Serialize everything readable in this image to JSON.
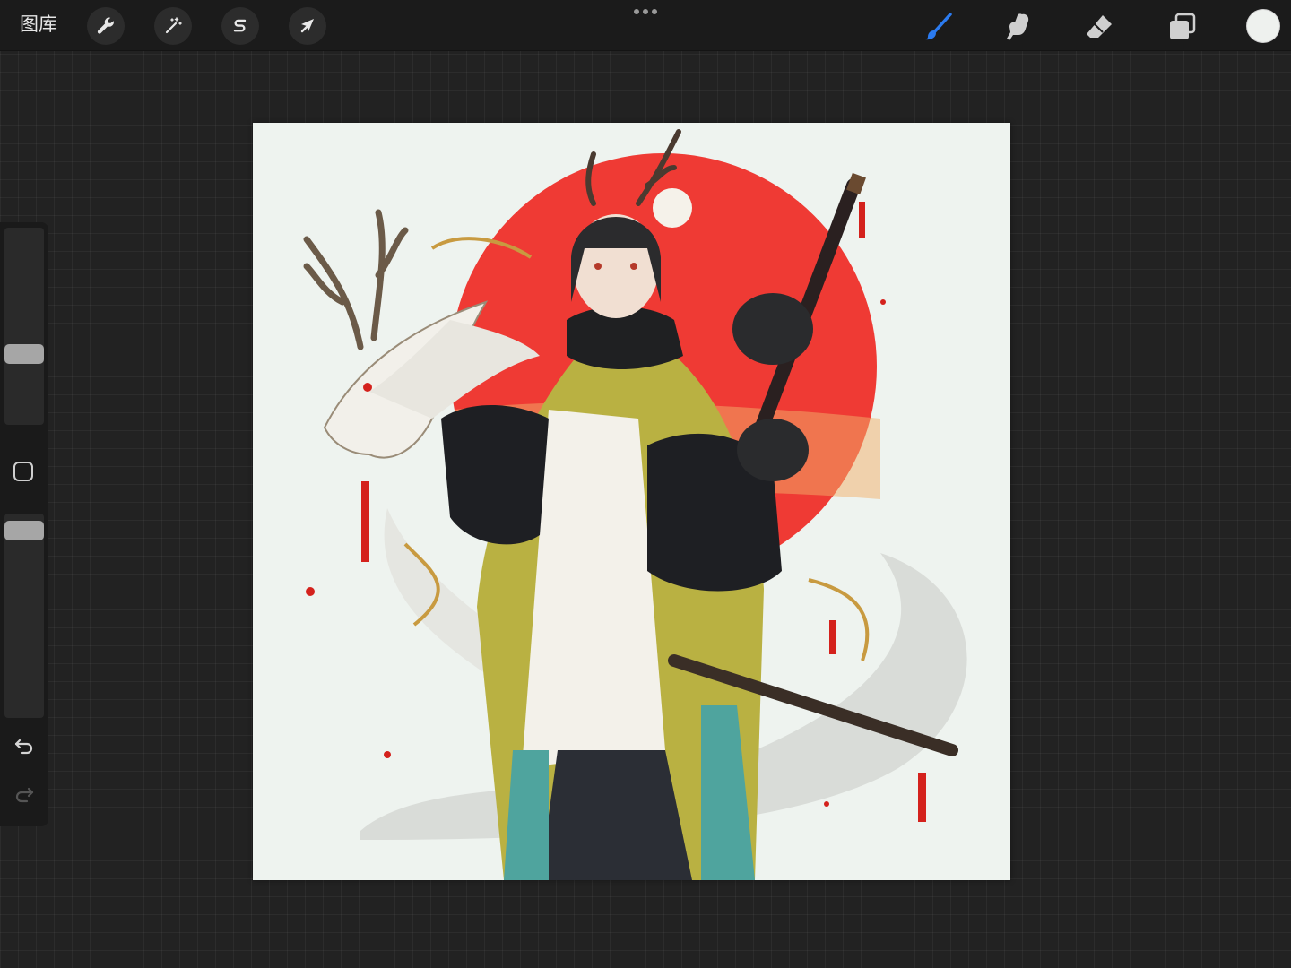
{
  "topbar": {
    "gallery_label": "图库",
    "left_tools": [
      {
        "name": "actions",
        "icon": "wrench-icon"
      },
      {
        "name": "adjustments",
        "icon": "magic-wand-icon"
      },
      {
        "name": "selection",
        "icon": "selection-s-icon"
      },
      {
        "name": "transform",
        "icon": "arrow-cursor-icon"
      }
    ],
    "right_tools": [
      {
        "name": "brush",
        "icon": "brush-icon",
        "active": true
      },
      {
        "name": "smudge",
        "icon": "smudge-finger-icon"
      },
      {
        "name": "eraser",
        "icon": "eraser-icon"
      },
      {
        "name": "layers",
        "icon": "layers-icon"
      }
    ],
    "current_color": "#eef1ee",
    "accent_color": "#2b7bf0"
  },
  "sidebar": {
    "brush_size_level": 0.35,
    "opacity_level": 0.95,
    "icons": [
      "modify-square-icon",
      "undo-icon",
      "redo-icon"
    ]
  },
  "canvas": {
    "background": "#eef3ef",
    "sun_color": "#ef3a34",
    "artwork": "illustration-dragon-warrior"
  }
}
